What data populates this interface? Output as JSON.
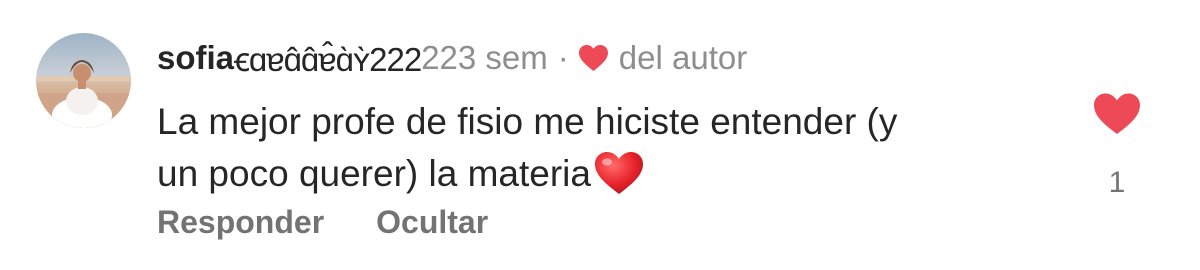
{
  "comment": {
    "username": "sofia",
    "username_suffix": "ꞓɑɐɑ̂ɑ̂ɐ̂ɑ̀ʏ̀222",
    "time": "223 sem",
    "separator": "·",
    "author_label": "del autor",
    "text_line1": "La mejor profe de fisio me hiciste entender (y",
    "text_line2": "un poco querer) la materia",
    "like_count": "1"
  },
  "actions": {
    "reply_label": "Responder",
    "hide_label": "Ocultar"
  },
  "colors": {
    "like_red": "#ed4956",
    "text_primary": "#262626",
    "text_secondary": "#8e8e8e"
  },
  "icons": {
    "author_like": "heart-icon",
    "comment_emoji": "red-heart-emoji",
    "like_button": "heart-filled-icon"
  }
}
